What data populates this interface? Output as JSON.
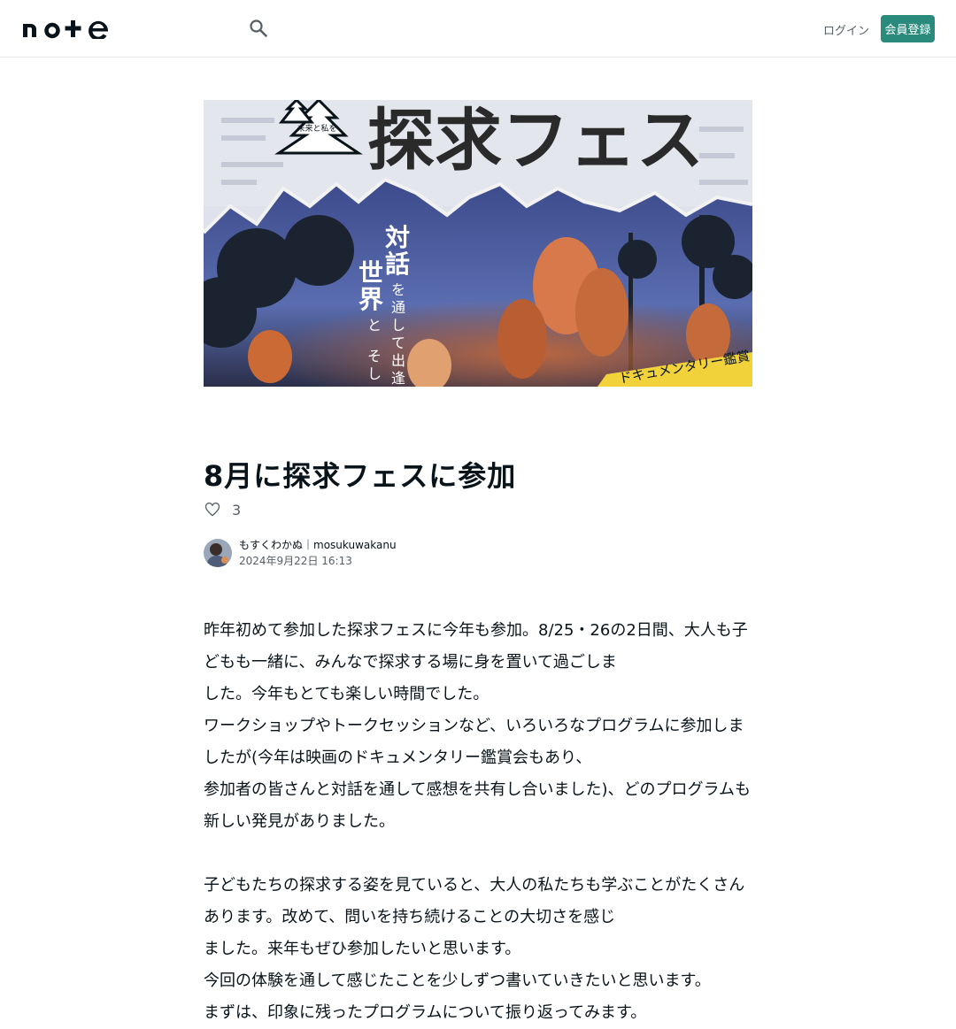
{
  "header": {
    "logo_text": "note",
    "search_icon": "search-icon",
    "login_label": "ログイン",
    "signup_label": "会員登録"
  },
  "eyecatch": {
    "alt": "探求フェス フライヤー写真",
    "headline": "探求フェス",
    "badge_text": "未来と私をつなげよう",
    "vertical_text_1": "対話を通して出逢いた",
    "vertical_text_2": "世界と、そして",
    "banner_text": "ドキュメンタリー鑑賞"
  },
  "article": {
    "title": "8月に探求フェスに参加",
    "like_count": "3",
    "author_name": "もすくわかぬ｜mosukuwakanu",
    "date": "2024年9月22日 16:13",
    "paragraphs": [
      "昨年初めて参加した探求フェスに今年も参加。8/25・26の2日間、大人も子どもも一緒に、みんなで探求する場に身を置いて過ごしま",
      "した。今年もとても楽しい時間でした。",
      "ワークショップやトークセッションなど、いろいろなプログラムに参加しましたが(今年は映画のドキュメンタリー鑑賞会もあり、",
      "参加者の皆さんと対話を通して感想を共有し合いました)、どのプログラムも新しい発見がありました。",
      "",
      "子どもたちの探求する姿を見ていると、大人の私たちも学ぶことがたくさんあります。改めて、問いを持ち続けることの大切さを感じ",
      "ました。来年もぜひ参加したいと思います。",
      "今回の体験を通して感じたことを少しずつ書いていきたいと思います。",
      "まずは、印象に残ったプログラムについて振り返ってみます。"
    ]
  },
  "colors": {
    "accent": "#2a8b7d",
    "text": "#08131a",
    "muted": "#555f66"
  }
}
